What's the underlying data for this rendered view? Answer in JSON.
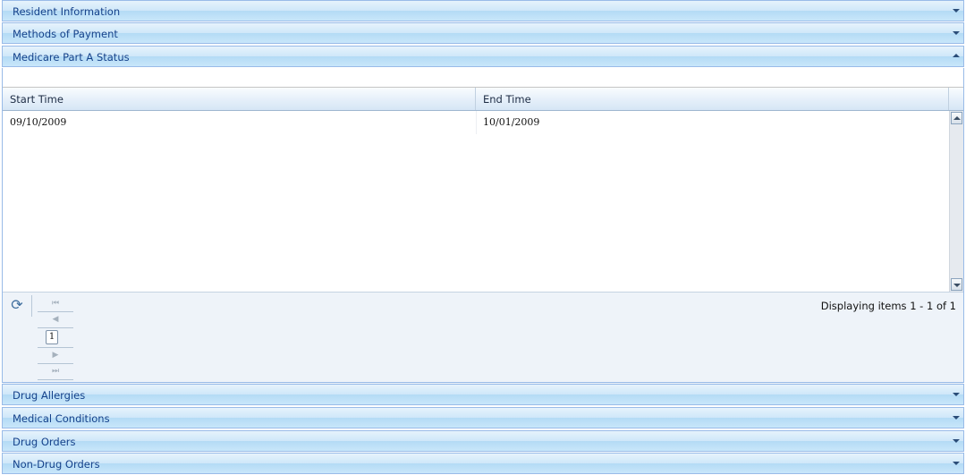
{
  "panels_top": [
    {
      "title": "Resident Information",
      "state": "collapsed"
    },
    {
      "title": "Methods of Payment",
      "state": "collapsed"
    },
    {
      "title": "Medicare Part A Status",
      "state": "expanded"
    }
  ],
  "grid": {
    "columns": [
      "Start Time",
      "End Time"
    ],
    "rows": [
      {
        "start_time": "09/10/2009",
        "end_time": "10/01/2009"
      }
    ]
  },
  "pager": {
    "current_page": "1",
    "display_message": "Displaying items 1 - 1 of 1"
  },
  "panels_bottom": [
    {
      "title": "Drug Allergies",
      "state": "collapsed"
    },
    {
      "title": "Medical Conditions",
      "state": "collapsed"
    },
    {
      "title": "Drug Orders",
      "state": "collapsed"
    },
    {
      "title": "Non-Drug Orders",
      "state": "collapsed"
    }
  ],
  "icons": {
    "collapse_tool": "chevron-up-icon",
    "expand_tool": "chevron-down-icon",
    "refresh": "refresh-icon",
    "first_page": "first-page-icon",
    "prev_page": "prev-page-icon",
    "next_page": "next-page-icon",
    "last_page": "last-page-icon"
  },
  "colors": {
    "header_border": "#99bbe8",
    "header_text": "#15428b",
    "pager_background": "#eef3f9"
  }
}
